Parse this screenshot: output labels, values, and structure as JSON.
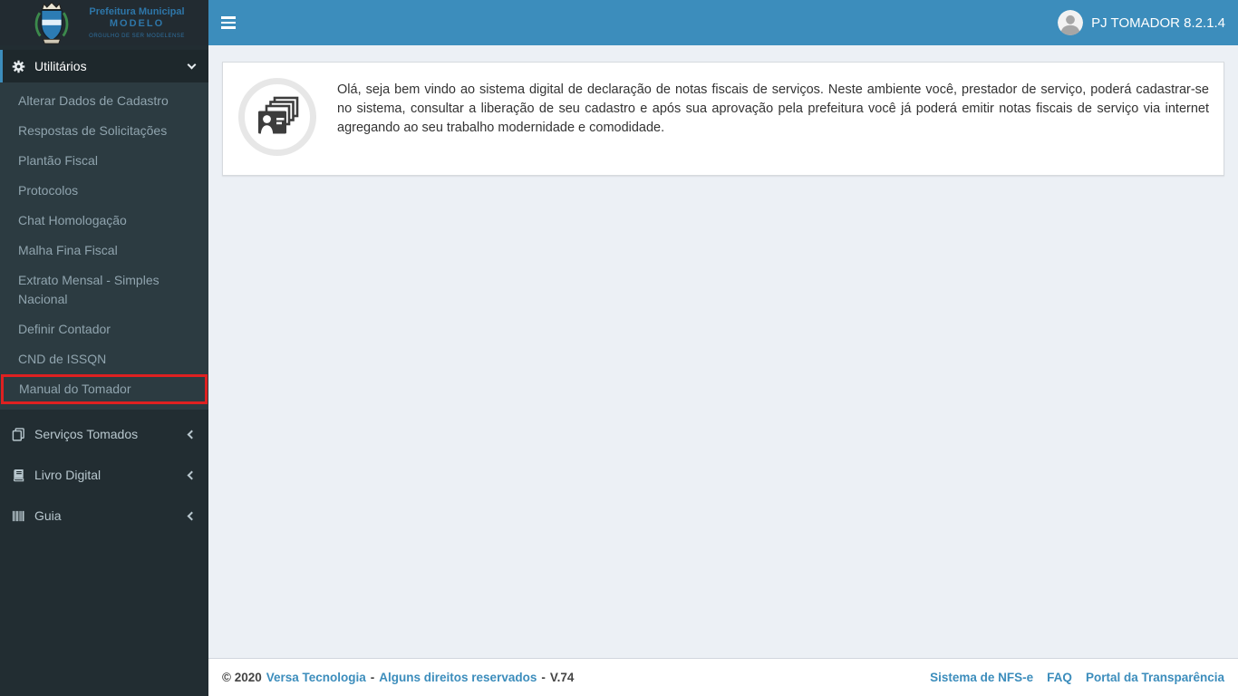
{
  "brand": {
    "line1": "Prefeitura Municipal",
    "line2": "MODELO",
    "tagline": "ORGULHO DE SER MODELENSE"
  },
  "topbar": {
    "user_label": "PJ TOMADOR 8.2.1.4"
  },
  "sidebar": {
    "utilitarios": {
      "label": "Utilitários",
      "state": "expanded",
      "items": [
        "Alterar Dados de Cadastro",
        "Respostas de Solicitações",
        "Plantão Fiscal",
        "Protocolos",
        "Chat Homologação",
        "Malha Fina Fiscal",
        "Extrato Mensal - Simples Nacional",
        "Definir Contador",
        "CND de ISSQN",
        "Manual do Tomador"
      ],
      "highlighted_item": "Manual do Tomador"
    },
    "sections": [
      {
        "label": "Serviços Tomados",
        "icon": "copy-icon",
        "state": "collapsed"
      },
      {
        "label": "Livro Digital",
        "icon": "book-icon",
        "state": "collapsed"
      },
      {
        "label": "Guia",
        "icon": "barcode-icon",
        "state": "collapsed"
      }
    ]
  },
  "main": {
    "welcome_text": "Olá, seja bem vindo ao sistema digital de declaração de notas fiscais de serviços. Neste ambiente você, prestador de serviço, poderá cadastrar-se no sistema, consultar a liberação de seu cadastro e após sua aprovação pela prefeitura você já poderá emitir notas fiscais de serviço via internet agregando ao seu trabalho modernidade e comodidade."
  },
  "footer": {
    "copyright": "© 2020",
    "company_link": "Versa Tecnologia",
    "sep1": "-",
    "rights_link": "Alguns direitos reservados",
    "sep2": "-",
    "version": "V.74",
    "links": [
      "Sistema de NFS-e",
      "FAQ",
      "Portal da Transparência"
    ]
  },
  "colors": {
    "topbar": "#3c8dbc",
    "sidebar": "#222d32",
    "submenu": "#2c3b41",
    "active_row": "#1e282c",
    "highlight_border": "#df2121",
    "content_bg": "#ecf0f5",
    "link": "#3c8dbc"
  }
}
